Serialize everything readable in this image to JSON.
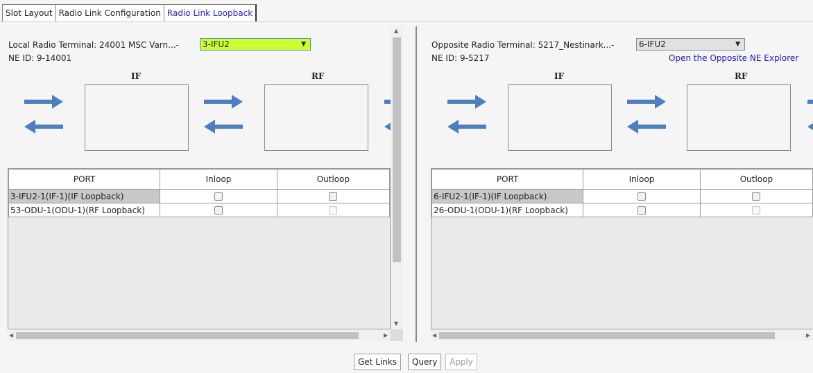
{
  "tabs": [
    "Slot Layout",
    "Radio Link Configuration",
    "Radio Link Loopback"
  ],
  "local": {
    "label": "Local Radio Terminal: 24001 MSC Varn...-",
    "select_value": "3-IFU2",
    "ne_id": "NE ID: 9-14001",
    "col_if": "IF",
    "col_rf": "RF",
    "table": {
      "headers": [
        "PORT",
        "Inloop",
        "Outloop"
      ],
      "rows": [
        {
          "port": "3-IFU2-1(IF-1)(IF Loopback)"
        },
        {
          "port": "53-ODU-1(ODU-1)(RF Loopback)"
        }
      ]
    }
  },
  "opposite": {
    "label": "Opposite Radio Terminal: 5217_Nestinark...-",
    "select_value": "6-IFU2",
    "ne_id": "NE ID: 9-5217",
    "explorer_link": "Open the Opposite NE Explorer",
    "col_if": "IF",
    "col_rf": "RF",
    "table": {
      "headers": [
        "PORT",
        "Inloop",
        "Outloop"
      ],
      "rows": [
        {
          "port": "6-IFU2-1(IF-1)(IF Loopback)"
        },
        {
          "port": "26-ODU-1(ODU-1)(RF Loopback)"
        }
      ]
    }
  },
  "buttons": {
    "get_links": "Get Links",
    "query": "Query",
    "apply": "Apply"
  },
  "colors": {
    "accent_select": "#ccff33",
    "arrow": "#4c7ec0",
    "link": "#1a1acc"
  }
}
